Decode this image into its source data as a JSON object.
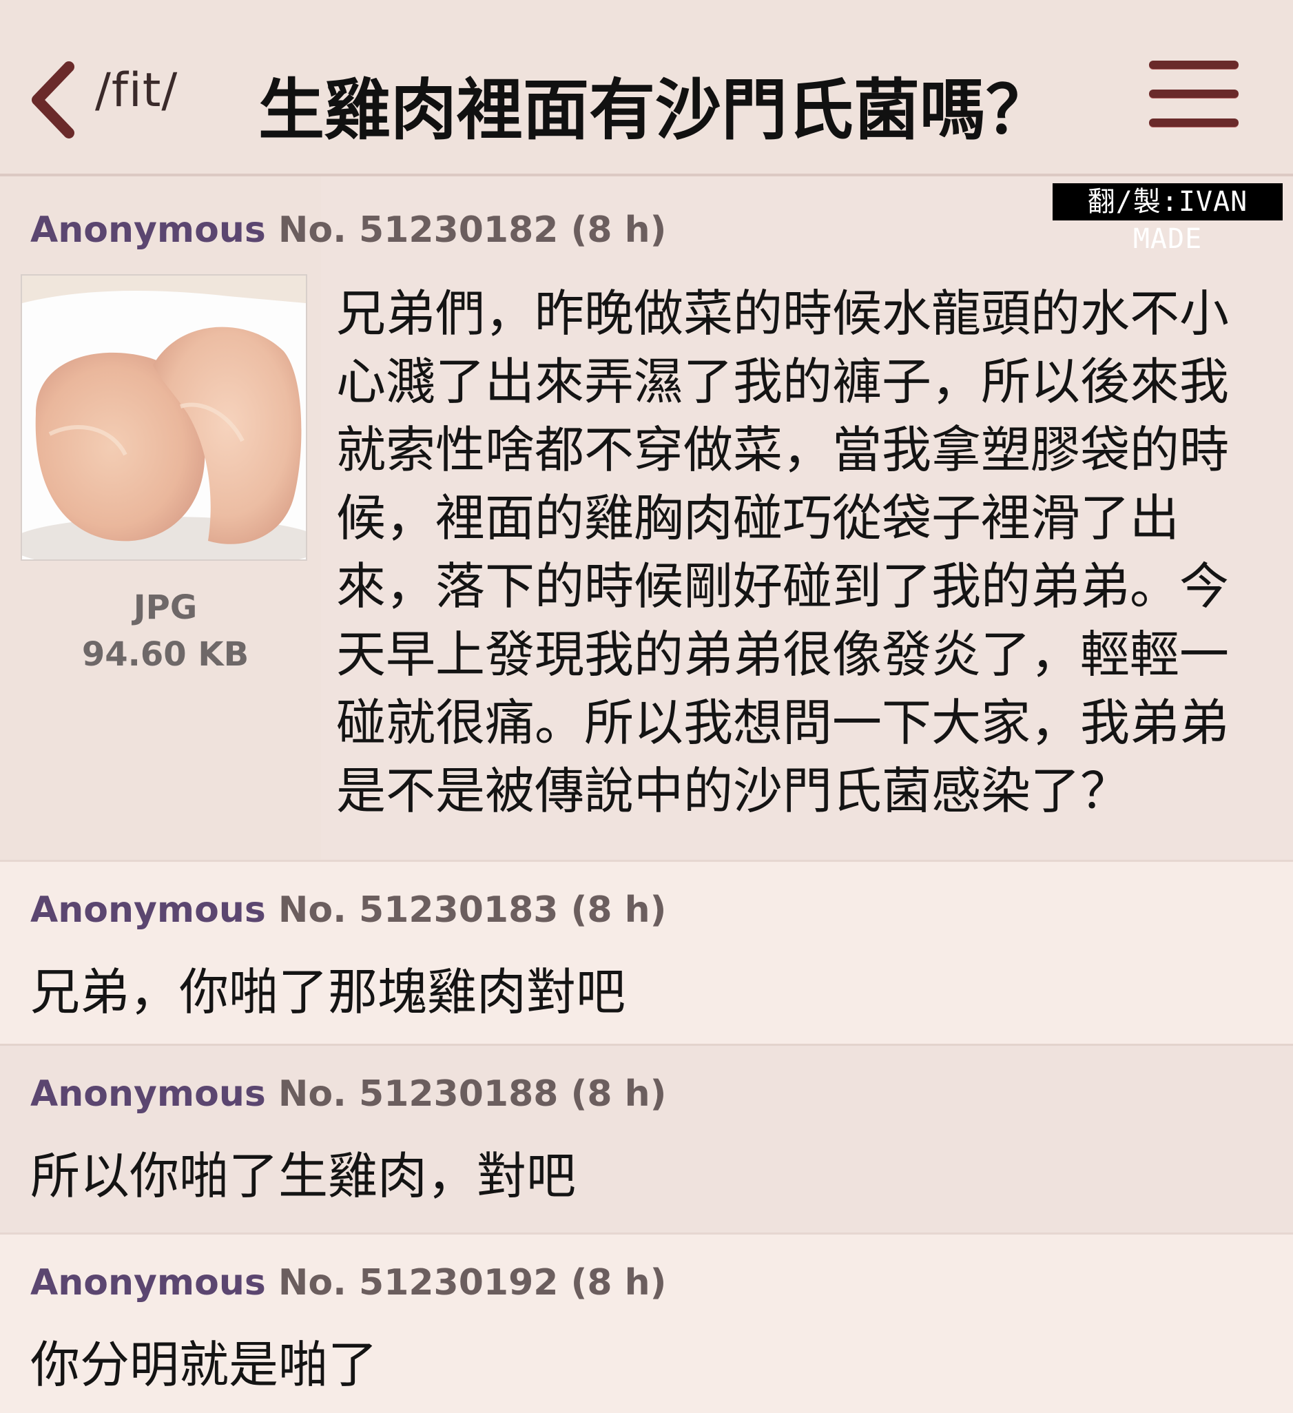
{
  "header": {
    "board": "/fit/",
    "title": "生雞肉裡面有沙門氏菌嗎？"
  },
  "credit": "翻/製:IVAN MADE",
  "op": {
    "name": "Anonymous",
    "number": "No. 51230182 (8 h)",
    "file_type": "JPG",
    "file_size": "94.60 KB",
    "text": "兄弟們，昨晚做菜的時候水龍頭的水不小心濺了出來弄濕了我的褲子，所以後來我就索性啥都不穿做菜，當我拿塑膠袋的時候，裡面的雞胸肉碰巧從袋子裡滑了出來，落下的時候剛好碰到了我的弟弟。今天早上發現我的弟弟很像發炎了，輕輕一碰就很痛。所以我想問一下大家，我弟弟是不是被傳說中的沙門氏菌感染了？"
  },
  "replies": [
    {
      "name": "Anonymous",
      "number": "No. 51230183 (8 h)",
      "text": "兄弟，你啪了那塊雞肉對吧"
    },
    {
      "name": "Anonymous",
      "number": "No. 51230188 (8 h)",
      "text": "所以你啪了生雞肉，對吧"
    },
    {
      "name": "Anonymous",
      "number": "No. 51230192 (8 h)",
      "text": "你分明就是啪了"
    }
  ],
  "icons": {
    "back": "chevron-left-icon",
    "menu": "hamburger-menu-icon"
  },
  "colors": {
    "name": "#5b4670",
    "menu": "#6a2a2a",
    "back": "#6a2a2a"
  }
}
